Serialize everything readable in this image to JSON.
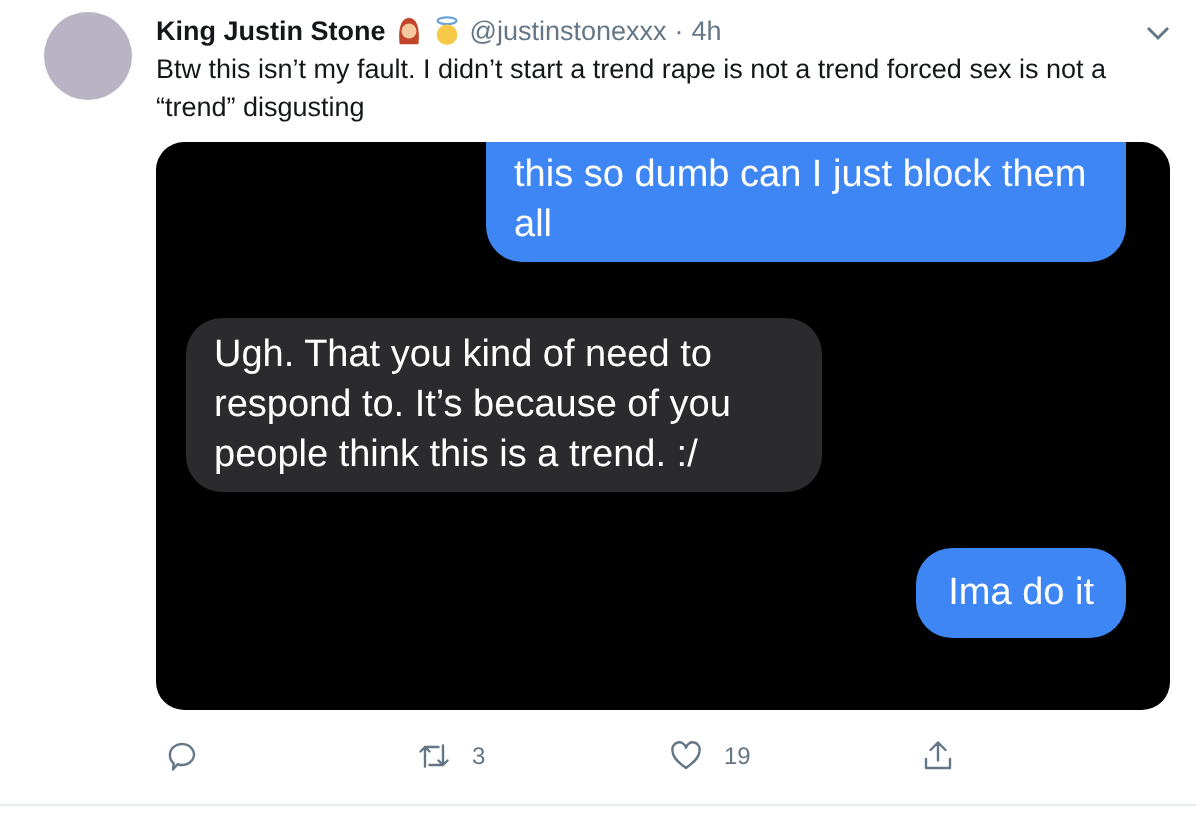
{
  "tweet": {
    "name": "King Justin Stone",
    "handle": "@justinstonexxx",
    "separator": "·",
    "time": "4h",
    "text": "Btw this isn’t my fault. I didn’t start a trend rape is not a trend forced sex is not a “trend” disgusting"
  },
  "messages": [
    {
      "kind": "sent",
      "text": "this so dumb can I just block them all"
    },
    {
      "kind": "received",
      "text": "Ugh. That you kind of need to respond to. It’s because of you people think this is a trend. :/"
    },
    {
      "kind": "sent",
      "text": "Ima do it"
    }
  ],
  "actions": {
    "retweets": "3",
    "likes": "19"
  }
}
